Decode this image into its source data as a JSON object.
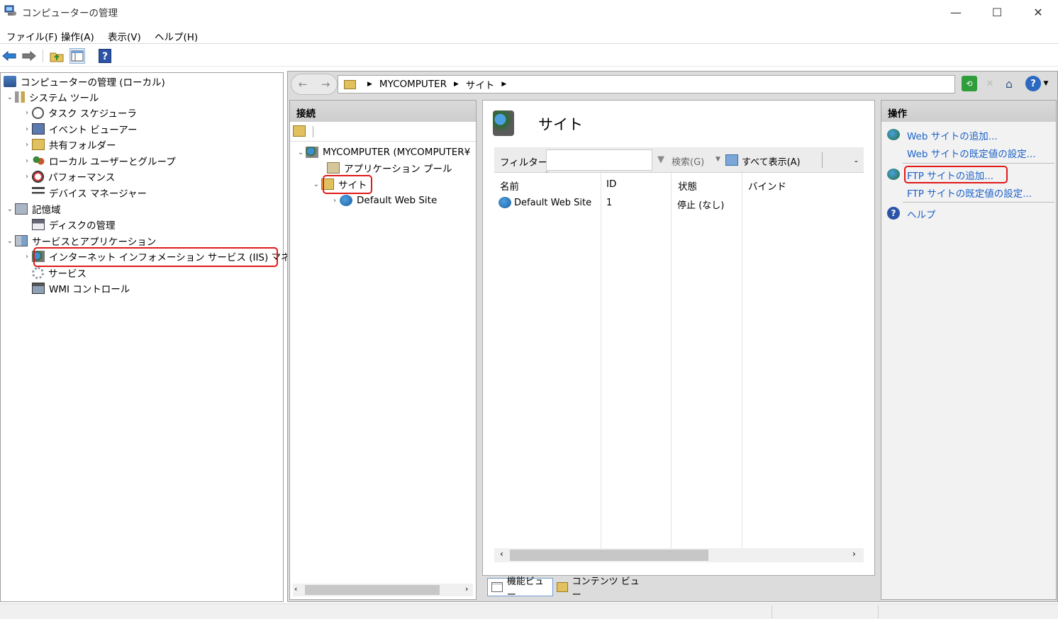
{
  "window": {
    "title": "コンピューターの管理",
    "minimize": "—",
    "maximize": "☐",
    "close": "✕"
  },
  "menu": {
    "file": "ファイル(F)",
    "action": "操作(A)",
    "view": "表示(V)",
    "help": "ヘルプ(H)"
  },
  "toolbar": {
    "help_glyph": "?"
  },
  "tree": {
    "root": "コンピューターの管理 (ローカル)",
    "system_tools": "システム ツール",
    "task_scheduler": "タスク スケジューラ",
    "event_viewer": "イベント ビューアー",
    "shared_folders": "共有フォルダー",
    "local_users": "ローカル ユーザーとグループ",
    "performance": "パフォーマンス",
    "device_manager": "デバイス マネージャー",
    "storage": "記憶域",
    "disk_management": "ディスクの管理",
    "services_apps": "サービスとアプリケーション",
    "iis_manager": "インターネット インフォメーション サービス (IIS) マネージャー",
    "services": "サービス",
    "wmi": "WMI コントロール"
  },
  "address": {
    "seg1": "MYCOMPUTER",
    "seg2": "サイト"
  },
  "connections": {
    "header": "接続",
    "server": "MYCOMPUTER (MYCOMPUTER¥",
    "app_pools": "アプリケーション プール",
    "sites": "サイト",
    "default_site": "Default Web Site"
  },
  "center": {
    "title": "サイト",
    "filter_label": "フィルター:",
    "filter_value": "",
    "search": "検索(G)",
    "show_all": "すべて表示(A)",
    "columns": {
      "name": "名前",
      "id": "ID",
      "state": "状態",
      "binding": "バインド"
    },
    "rows": [
      {
        "name": "Default Web Site",
        "id": "1",
        "state": "停止 (なし)",
        "binding": ""
      }
    ],
    "feature_view": "機能ビュー",
    "content_view": "コンテンツ ビュー"
  },
  "actions": {
    "header": "操作",
    "add_web": "Web サイトの追加...",
    "web_defaults": "Web サイトの既定値の設定...",
    "add_ftp": "FTP サイトの追加...",
    "ftp_defaults": "FTP サイトの既定値の設定...",
    "help": "ヘルプ"
  },
  "colors": {
    "highlight": "#e11919",
    "link": "#1c62c7",
    "pane_header": "#cdcdcd",
    "frame": "#dcdcdc"
  }
}
